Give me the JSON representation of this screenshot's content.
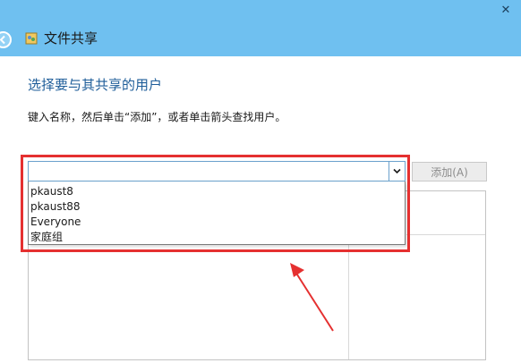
{
  "window": {
    "title": "文件共享",
    "close_label": "✕"
  },
  "page": {
    "heading": "选择要与其共享的用户",
    "instruction": "键入名称，然后单击“添加”，或者单击箭头查找用户。"
  },
  "combo": {
    "value": "",
    "options": [
      "pkaust8",
      "pkaust88",
      "Everyone",
      "家庭组"
    ]
  },
  "add_button": {
    "label": "添加(A)"
  },
  "icons": {
    "back": "back-arrow-icon",
    "app": "file-share-icon",
    "dropdown": "chevron-down-icon"
  },
  "colors": {
    "titlebar": "#6fc0f0",
    "heading": "#1e5d99",
    "highlight": "#e53030",
    "combo_border": "#6aa1cc"
  }
}
